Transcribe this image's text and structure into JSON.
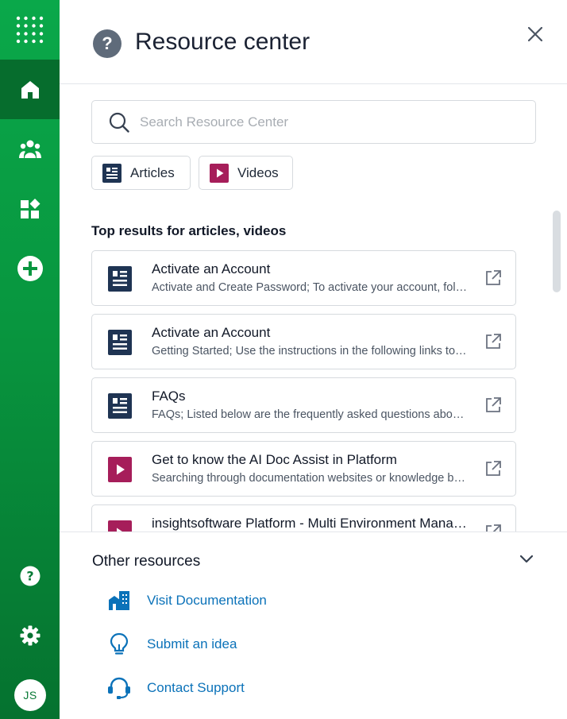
{
  "sidebar": {
    "items": [
      {
        "name": "grid-menu-icon"
      },
      {
        "name": "home-icon",
        "active": true
      },
      {
        "name": "users-icon"
      },
      {
        "name": "widgets-icon"
      },
      {
        "name": "add-circle-icon"
      },
      {
        "name": "help-icon"
      },
      {
        "name": "settings-icon"
      }
    ],
    "avatar_initials": "JS"
  },
  "header": {
    "title": "Resource center"
  },
  "search": {
    "placeholder": "Search Resource Center",
    "value": ""
  },
  "filters": [
    {
      "label": "Articles",
      "icon": "article-icon"
    },
    {
      "label": "Videos",
      "icon": "video-icon"
    }
  ],
  "results": {
    "heading": "Top results for articles, videos",
    "items": [
      {
        "type": "article",
        "title": "Activate an Account",
        "description": "Activate and Create Password; To activate your account, follow the steps"
      },
      {
        "type": "article",
        "title": "Activate an Account",
        "description": "Getting Started; Use the instructions in the following links to get started"
      },
      {
        "type": "article",
        "title": "FAQs",
        "description": "FAQs; Listed below are the frequently asked questions about the platform"
      },
      {
        "type": "video",
        "title": "Get to know the AI Doc Assist in Platform",
        "description": "Searching through documentation websites or knowledge bases can be slow"
      },
      {
        "type": "video",
        "title": "insightsoftware Platform - Multi Environment Management",
        "description": ""
      }
    ]
  },
  "other_resources": {
    "heading": "Other resources",
    "links": [
      {
        "label": "Visit Documentation",
        "icon": "documentation-building-icon"
      },
      {
        "label": "Submit an idea",
        "icon": "lightbulb-icon"
      },
      {
        "label": "Contact Support",
        "icon": "headset-icon"
      }
    ]
  },
  "colors": {
    "sidebar_green": "#08963f",
    "article_navy": "#1f3453",
    "video_maroon": "#a61e5a",
    "link_blue": "#0b72b9"
  }
}
